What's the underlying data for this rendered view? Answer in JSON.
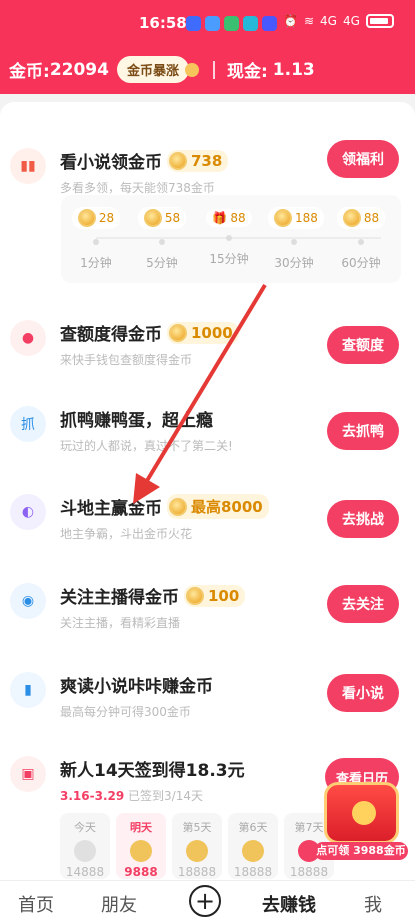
{
  "status": {
    "time": "16:58",
    "network": "4G",
    "network2": "4G"
  },
  "header": {
    "coin_label": "金币:",
    "coin_value": "22094",
    "boom": "金币暴涨",
    "cash_label": "现金:",
    "cash_value": "1.13"
  },
  "tasks": [
    {
      "title": "看小说领金币",
      "bonus": "738",
      "desc": "多看多领，每天能领738金币",
      "action": "领福利"
    },
    {
      "title": "查额度得金币",
      "bonus": "1000",
      "desc": "来快手钱包查额度得金币",
      "action": "查额度"
    },
    {
      "title": "抓鸭赚鸭蛋，超上瘾",
      "desc": "玩过的人都说，真过不了第二关!",
      "action": "去抓鸭"
    },
    {
      "title": "斗地主赢金币",
      "bonus": "最高8000",
      "desc": "地主争霸，斗出金币火花",
      "action": "去挑战"
    },
    {
      "title": "关注主播得金币",
      "bonus": "100",
      "desc": "关注主播，看精彩直播",
      "action": "去关注"
    },
    {
      "title": "爽读小说咔咔赚金币",
      "desc": "最高每分钟可得300金币",
      "action": "看小说"
    },
    {
      "title": "新人14天签到得18.3元",
      "desc": "已签到3/14天",
      "date": "3.16-3.29",
      "action": "查看日历"
    }
  ],
  "progress": [
    {
      "reward": "28",
      "time": "1分钟"
    },
    {
      "reward": "58",
      "time": "5分钟"
    },
    {
      "reward": "88",
      "time": "15分钟"
    },
    {
      "reward": "188",
      "time": "30分钟"
    },
    {
      "reward": "88",
      "time": "60分钟"
    }
  ],
  "signin": [
    {
      "day": "今天",
      "value": "14888"
    },
    {
      "day": "明天",
      "value": "9888"
    },
    {
      "day": "第5天",
      "value": "18888"
    },
    {
      "day": "第6天",
      "value": "18888"
    },
    {
      "day": "第7天",
      "value": "18888"
    }
  ],
  "reward": {
    "text": "点可领 3988金币",
    "partial": "28"
  },
  "tabs": [
    "首页",
    "朋友",
    "+",
    "去赚钱",
    "我"
  ],
  "colors": {
    "brand": "#f8335a",
    "button": "#f33f64",
    "coin": "#f0b43f"
  }
}
